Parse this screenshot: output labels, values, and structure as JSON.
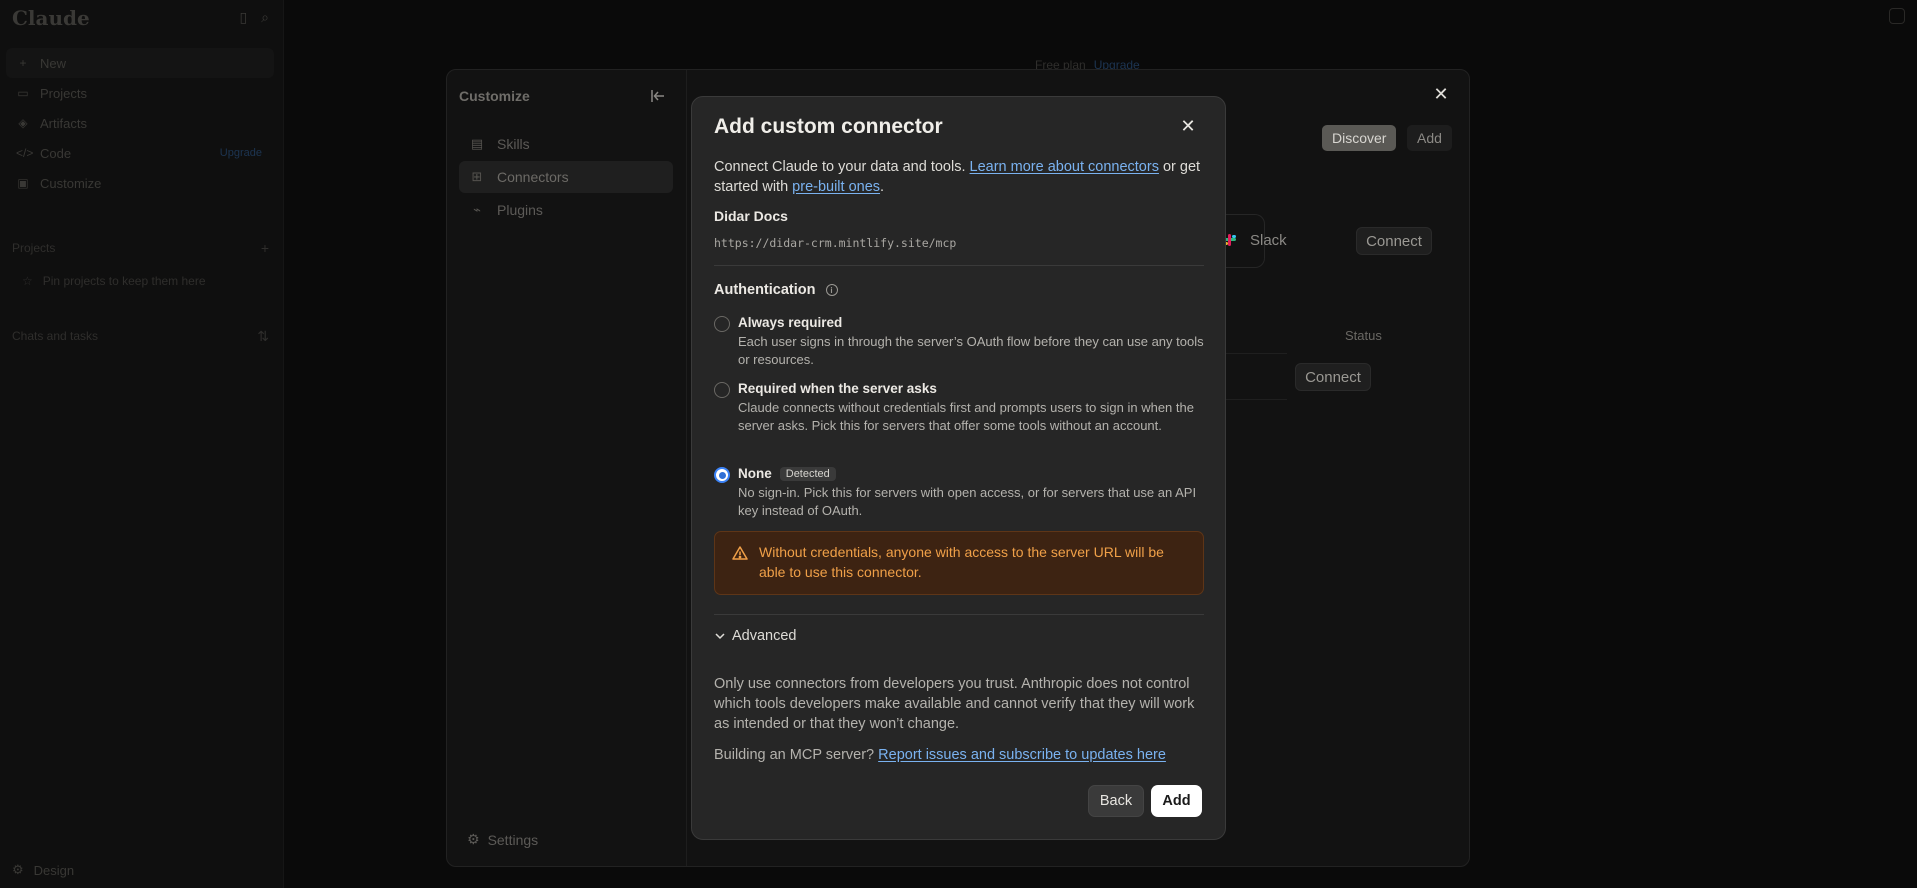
{
  "app": {
    "logo": "Claude",
    "nav": [
      {
        "label": "New",
        "icon": "plus-icon"
      },
      {
        "label": "Projects",
        "icon": "folder-icon"
      },
      {
        "label": "Artifacts",
        "icon": "artifacts-icon"
      },
      {
        "label": "Code",
        "icon": "code-icon",
        "badge": "Upgrade"
      },
      {
        "label": "Customize",
        "icon": "briefcase-icon"
      }
    ],
    "projects_header": "Projects",
    "projects_empty": "Pin projects to keep them here",
    "chats_header": "Chats and tasks",
    "bottom_label": "Design",
    "plan_text": "Free plan",
    "plan_upgrade": "Upgrade"
  },
  "customize": {
    "title": "Customize",
    "items": [
      {
        "label": "Skills",
        "icon": "skills-icon"
      },
      {
        "label": "Connectors",
        "icon": "connectors-icon"
      },
      {
        "label": "Plugins",
        "icon": "plugins-icon"
      }
    ],
    "settings_label": "Settings",
    "tabs": {
      "discover": "Discover",
      "add": "Add"
    },
    "slack_name": "Slack",
    "connect_label": "Connect",
    "status_header": "Status"
  },
  "modal": {
    "title": "Add custom connector",
    "intro_before": "Connect Claude to your data and tools. ",
    "intro_link1": "Learn more about connectors",
    "intro_middle": " or get started with ",
    "intro_link2": "pre-built ones",
    "intro_end": ".",
    "connector_name": "Didar Docs",
    "connector_url": "https://didar-crm.mintlify.site/mcp",
    "auth_heading": "Authentication",
    "options": [
      {
        "title": "Always required",
        "desc": "Each user signs in through the server’s OAuth flow before they can use any tools or resources.",
        "checked": false
      },
      {
        "title": "Required when the server asks",
        "desc": "Claude connects without credentials first and prompts users to sign in when the server asks. Pick this for servers that offer some tools without an account.",
        "checked": false
      },
      {
        "title": "None",
        "badge": "Detected",
        "desc": "No sign-in. Pick this for servers with open access, or for servers that use an API key instead of OAuth.",
        "checked": true
      }
    ],
    "warning": "Without credentials, anyone with access to the server URL will be able to use this connector.",
    "advanced_label": "Advanced",
    "trust_text": "Only use connectors from developers you trust. Anthropic does not control which tools developers make available and cannot verify that they will work as intended or that they won’t change.",
    "mcp_prefix": "Building an MCP server? ",
    "mcp_link": "Report issues and subscribe to updates here",
    "back_label": "Back",
    "add_label": "Add"
  },
  "colors": {
    "accent": "#3b82f6",
    "link": "#7ab2f0",
    "warning_text": "#f0a048",
    "warning_bg": "#3d2312"
  }
}
